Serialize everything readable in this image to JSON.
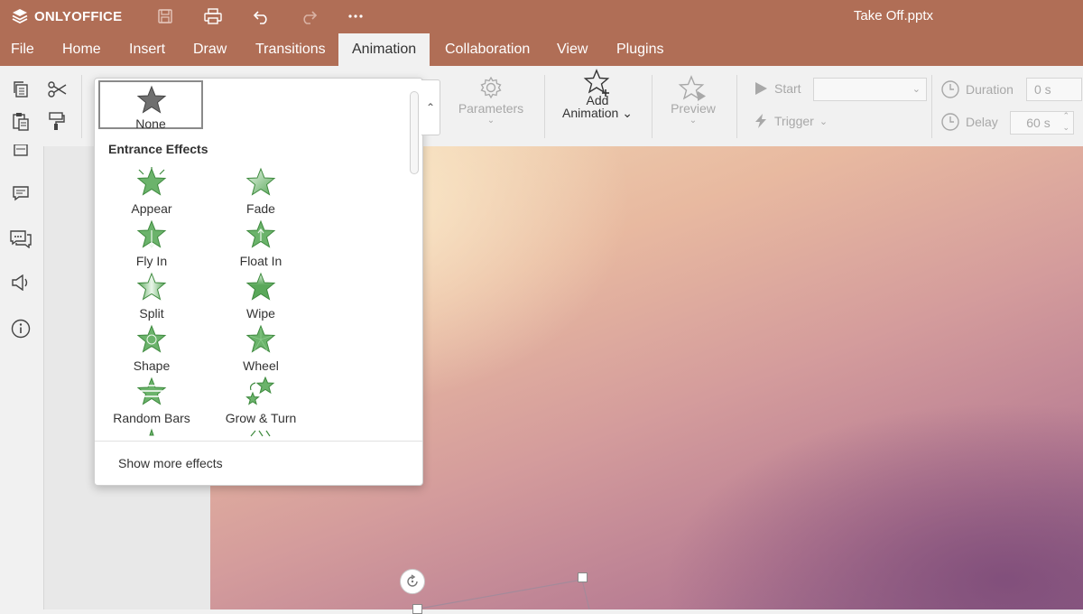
{
  "app": {
    "logo_text": "ONLYOFFICE",
    "doc_title": "Take Off.pptx"
  },
  "menu": {
    "tabs": [
      {
        "label": "File"
      },
      {
        "label": "Home"
      },
      {
        "label": "Insert"
      },
      {
        "label": "Draw"
      },
      {
        "label": "Transitions"
      },
      {
        "label": "Animation"
      },
      {
        "label": "Collaboration"
      },
      {
        "label": "View"
      },
      {
        "label": "Plugins"
      }
    ],
    "active_tab": "Animation"
  },
  "toolbar": {
    "parameters_label": "Parameters",
    "add_label": "Add",
    "animation_label": "Animation",
    "preview_label": "Preview",
    "start_label": "Start",
    "start_value": "",
    "trigger_label": "Trigger",
    "duration_label": "Duration",
    "duration_value": "0 s",
    "delay_label": "Delay",
    "delay_value": "60 s"
  },
  "dropdown": {
    "none_label": "None",
    "section_heading": "Entrance Effects",
    "effects": [
      {
        "label": "Appear",
        "icon": "appear-star-icon"
      },
      {
        "label": "Fade",
        "icon": "fade-star-icon"
      },
      {
        "label": "Fly In",
        "icon": "fly-in-star-icon"
      },
      {
        "label": "Float In",
        "icon": "float-in-star-icon"
      },
      {
        "label": "Split",
        "icon": "split-star-icon"
      },
      {
        "label": "Wipe",
        "icon": "wipe-star-icon"
      },
      {
        "label": "Shape",
        "icon": "shape-star-icon"
      },
      {
        "label": "Wheel",
        "icon": "wheel-star-icon"
      },
      {
        "label": "Random Bars",
        "icon": "random-bars-star-icon"
      },
      {
        "label": "Grow & Turn",
        "icon": "grow-turn-star-icon"
      }
    ],
    "show_more_label": "Show more effects"
  },
  "colors": {
    "header_bg": "#b06e56",
    "effect_green": "#5aa85a",
    "none_star": "#6f6f6f"
  }
}
